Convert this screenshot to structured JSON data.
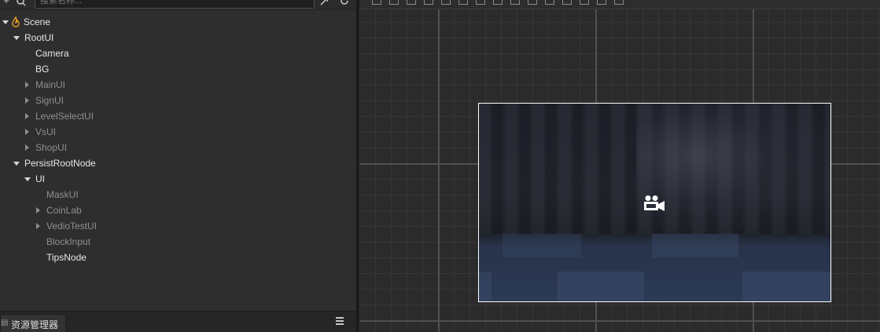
{
  "hierarchy": {
    "search_placeholder": "搜索名称...",
    "toolbar": {
      "add_icon": "plus-icon",
      "search_icon": "search-filter-icon",
      "locate_icon": "locate-icon",
      "refresh_icon": "refresh-icon"
    },
    "nodes": [
      {
        "label": "Scene",
        "depth": 0,
        "expand": "down",
        "style": "bright",
        "icon": "scene-flame-icon"
      },
      {
        "label": "RootUI",
        "depth": 1,
        "expand": "down",
        "style": "bright"
      },
      {
        "label": "Camera",
        "depth": 2,
        "expand": "none",
        "style": "bright"
      },
      {
        "label": "BG",
        "depth": 2,
        "expand": "none",
        "style": "bright"
      },
      {
        "label": "MainUI",
        "depth": 2,
        "expand": "right",
        "style": "dim"
      },
      {
        "label": "SignUI",
        "depth": 2,
        "expand": "right",
        "style": "dim"
      },
      {
        "label": "LevelSelectUI",
        "depth": 2,
        "expand": "right",
        "style": "dim"
      },
      {
        "label": "VsUI",
        "depth": 2,
        "expand": "right",
        "style": "dim"
      },
      {
        "label": "ShopUI",
        "depth": 2,
        "expand": "right",
        "style": "dim"
      },
      {
        "label": "PersistRootNode",
        "depth": 1,
        "expand": "down",
        "style": "bright"
      },
      {
        "label": "UI",
        "depth": 2,
        "expand": "down",
        "style": "bright"
      },
      {
        "label": "MaskUI",
        "depth": 3,
        "expand": "none",
        "style": "dim"
      },
      {
        "label": "CoinLab",
        "depth": 3,
        "expand": "right",
        "style": "dim"
      },
      {
        "label": "VedioTestUI",
        "depth": 3,
        "expand": "right",
        "style": "dim"
      },
      {
        "label": "BlockInput",
        "depth": 3,
        "expand": "none",
        "style": "dim"
      },
      {
        "label": "TipsNode",
        "depth": 3,
        "expand": "none",
        "style": "bright"
      }
    ]
  },
  "assets": {
    "tab_label": "资源管理器",
    "tab_icon": "panel-icon",
    "menu_icon": "hamburger-menu-icon"
  },
  "scene": {
    "toolbar_icons": [
      "move-tool-icon",
      "rotate-tool-icon",
      "scale-tool-icon",
      "rect-tool-icon",
      "align-left-icon",
      "align-center-icon",
      "align-right-icon",
      "align-top-icon",
      "align-middle-icon",
      "align-bottom-icon",
      "distribute-h-icon",
      "distribute-v-icon",
      "distribute-icon",
      "spacing-icon",
      "spacing-v-icon"
    ],
    "canvas_icon": "camera-icon",
    "frame_color": "#ffffff"
  },
  "colors": {
    "panel_bg": "#2e2e2e",
    "grid_major": "#505050",
    "grid_minor": "#363636",
    "text_bright": "#e6e6e6",
    "text_dim": "#8f8f8f",
    "scene_icon": "#e8a020"
  }
}
